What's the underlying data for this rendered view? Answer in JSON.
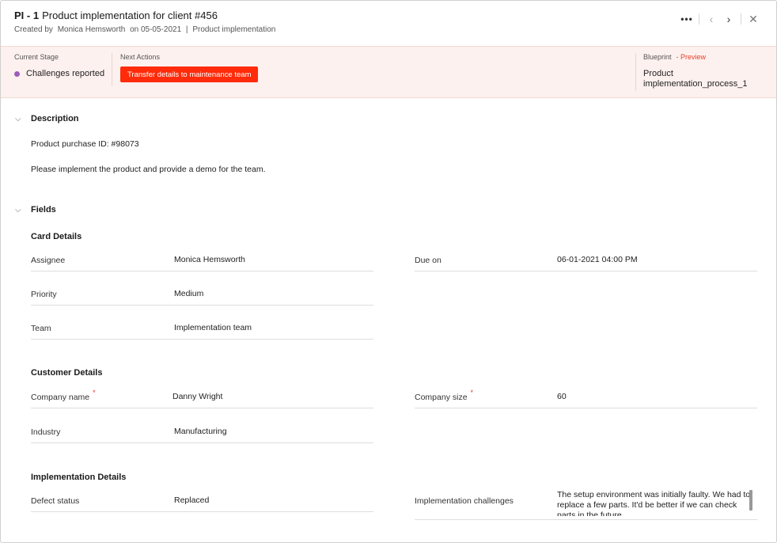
{
  "header": {
    "code": "PI - 1",
    "title": "Product implementation for client #456",
    "created_prefix": "Created by",
    "created_by": "Monica Hemsworth",
    "created_on": "on 05-05-2021",
    "separator": "|",
    "layout": "Product implementation",
    "more_icon": "more-horizontal-icon",
    "prev_icon": "chevron-left-icon",
    "next_icon": "chevron-right-icon",
    "close_icon": "close-icon"
  },
  "blueprint_band": {
    "current_stage_label": "Current Stage",
    "current_stage": "Challenges reported",
    "stage_dot_color": "#9a5fb8",
    "next_actions_label": "Next Actions",
    "next_action": "Transfer details to maintenance team",
    "action_color": "#ff2b0a",
    "blueprint_label": "Blueprint",
    "preview_label": "- Preview",
    "blueprint_name": "Product implementation_process_1",
    "band_color": "#fdf1ef"
  },
  "description": {
    "heading": "Description",
    "lines": [
      "Product purchase ID: #98073",
      "Please implement the product and provide a demo for the team."
    ]
  },
  "fields": {
    "heading": "Fields",
    "card_details": {
      "title": "Card Details",
      "assignee": {
        "label": "Assignee",
        "value": "Monica Hemsworth"
      },
      "due_on": {
        "label": "Due on",
        "value": "06-01-2021 04:00 PM"
      },
      "priority": {
        "label": "Priority",
        "value": "Medium"
      },
      "team": {
        "label": "Team",
        "value": "Implementation team"
      }
    },
    "customer_details": {
      "title": "Customer Details",
      "company_name": {
        "label": "Company name",
        "value": "Danny Wright",
        "required": "*"
      },
      "company_size": {
        "label": "Company size",
        "value": "60",
        "required": "*"
      },
      "industry": {
        "label": "Industry",
        "value": "Manufacturing"
      }
    },
    "implementation_details": {
      "title": "Implementation Details",
      "defect_status": {
        "label": "Defect status",
        "value": "Replaced"
      },
      "implementation_challenges": {
        "label": "Implementation challenges",
        "value": "The setup environment was initially faulty. We had to replace a few parts. It'd be better if we can check parts in the future."
      }
    }
  }
}
